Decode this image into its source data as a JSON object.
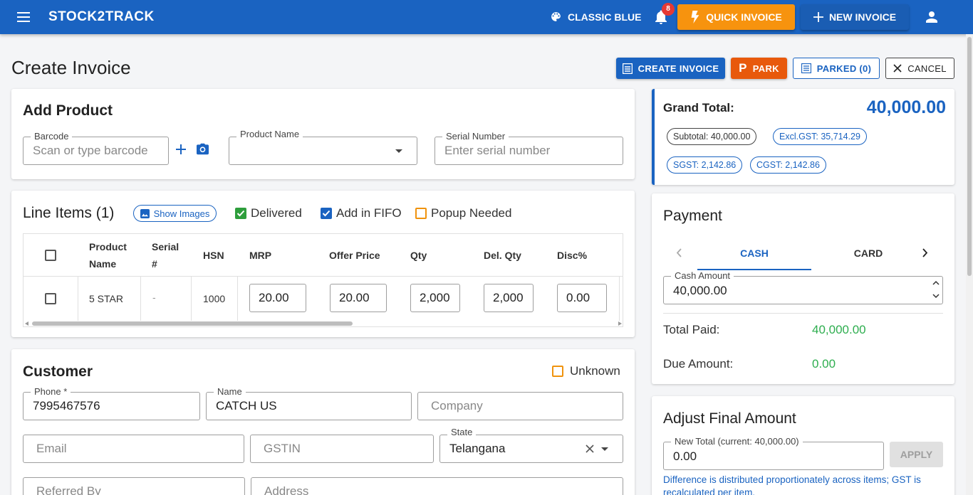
{
  "header": {
    "brand": "STOCK2TRACK",
    "theme_label": "CLASSIC BLUE",
    "notification_count": "8",
    "quick_invoice_label": "QUICK INVOICE",
    "new_invoice_label": "NEW INVOICE"
  },
  "page": {
    "title": "Create Invoice",
    "actions": {
      "create_label": "CREATE INVOICE",
      "park_label": "PARK",
      "parked_label": "PARKED (0)",
      "cancel_label": "CANCEL"
    }
  },
  "add_product": {
    "title": "Add Product",
    "barcode_label": "Barcode",
    "barcode_placeholder": "Scan or type barcode",
    "product_name_label": "Product Name",
    "product_name_value": "",
    "serial_label": "Serial Number",
    "serial_placeholder": "Enter serial number"
  },
  "line_items": {
    "title": "Line Items (1)",
    "show_images_label": "Show Images",
    "delivered_label": "Delivered",
    "delivered_checked": true,
    "fifo_label": "Add in FIFO",
    "fifo_checked": true,
    "popup_label": "Popup Needed",
    "popup_checked": false,
    "columns": {
      "product_name_1": "Product",
      "product_name_2": "Name",
      "serial_1": "Serial",
      "serial_2": "#",
      "hsn": "HSN",
      "mrp": "MRP",
      "offer_price": "Offer Price",
      "qty": "Qty",
      "del_qty": "Del. Qty",
      "disc": "Disc%"
    },
    "rows": [
      {
        "product_name": "5 STAR",
        "serial": "-",
        "hsn": "1000",
        "mrp": "20.00",
        "offer_price": "20.00",
        "qty": "2,000",
        "del_qty": "2,000",
        "disc": "0.00"
      }
    ]
  },
  "customer": {
    "title": "Customer",
    "unknown_label": "Unknown",
    "phone_label": "Phone *",
    "phone_value": "7995467576",
    "name_label": "Name",
    "name_value": "CATCH US",
    "company_placeholder": "Company",
    "email_placeholder": "Email",
    "gstin_placeholder": "GSTIN",
    "state_label": "State",
    "state_value": "Telangana",
    "referred_placeholder": "Referred By",
    "address_placeholder": "Address"
  },
  "totals": {
    "grand_total_label": "Grand Total:",
    "grand_total_value": "40,000.00",
    "subtotal": "Subtotal: 40,000.00",
    "excl_gst": "Excl.GST: 35,714.29",
    "sgst": "SGST: 2,142.86",
    "cgst": "CGST: 2,142.86"
  },
  "payment": {
    "title": "Payment",
    "tabs": [
      "CASH",
      "CARD"
    ],
    "active_tab": "CASH",
    "cash_amount_label": "Cash Amount",
    "cash_amount_value": "40,000.00",
    "total_paid_label": "Total Paid:",
    "total_paid_value": "40,000.00",
    "due_label": "Due Amount:",
    "due_value": "0.00"
  },
  "adjust": {
    "title": "Adjust Final Amount",
    "new_total_label": "New Total (current: 40,000.00)",
    "new_total_value": "0.00",
    "apply_label": "APPLY",
    "note": "Difference is distributed proportionately across items; GST is recalculated per item."
  },
  "colors": {
    "primary": "#1a63c1",
    "accent_orange": "#f7930e",
    "park_orange": "#e8590c",
    "success_green": "#2eae4f"
  }
}
